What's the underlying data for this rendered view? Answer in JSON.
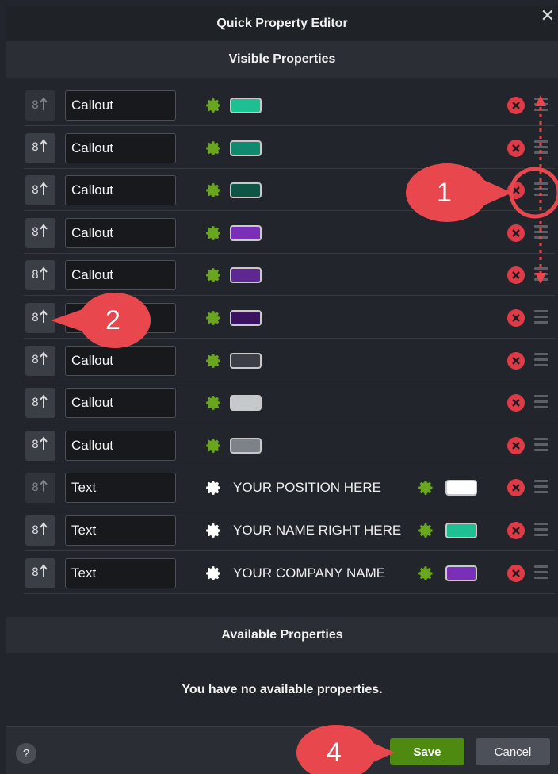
{
  "window": {
    "title": "Quick Property Editor",
    "close_glyph": "✕"
  },
  "sections": {
    "visible": "Visible Properties",
    "available": "Available Properties"
  },
  "rows": [
    {
      "label": "Callout",
      "kind": "callout",
      "color": "#1fbf94",
      "dim": true
    },
    {
      "label": "Callout",
      "kind": "callout",
      "color": "#108a6e",
      "dim": false
    },
    {
      "label": "Callout",
      "kind": "callout",
      "color": "#0d5544",
      "dim": false
    },
    {
      "label": "Callout",
      "kind": "callout",
      "color": "#7a2fb8",
      "dim": false
    },
    {
      "label": "Callout",
      "kind": "callout",
      "color": "#5e2890",
      "dim": false
    },
    {
      "label": "",
      "kind": "callout",
      "color": "#3a1260",
      "dim": false
    },
    {
      "label": "Callout",
      "kind": "callout",
      "color": "#3c4046",
      "dim": false
    },
    {
      "label": "Callout",
      "kind": "callout",
      "color": "#c6c9cc",
      "dim": false
    },
    {
      "label": "Callout",
      "kind": "callout",
      "color": "#7d8289",
      "dim": false
    },
    {
      "label": "Text",
      "kind": "text",
      "text": "YOUR POSITION HERE",
      "color": "#ffffff",
      "dim": true
    },
    {
      "label": "Text",
      "kind": "text",
      "text": "YOUR NAME RIGHT HERE",
      "color": "#1fbf94",
      "dim": false
    },
    {
      "label": "Text",
      "kind": "text",
      "text": "YOUR COMPANY NAME",
      "color": "#7a2fb8",
      "dim": false
    }
  ],
  "available_message": "You have no available properties.",
  "footer": {
    "help": "?",
    "save": "Save",
    "cancel": "Cancel"
  },
  "annotations": {
    "one": "1",
    "two": "2",
    "four": "4"
  },
  "colors": {
    "accent_green": "#4d8a0f",
    "delete_red": "#e03a47",
    "callout_red": "#e8474d",
    "gear_green": "#6aa51e"
  }
}
